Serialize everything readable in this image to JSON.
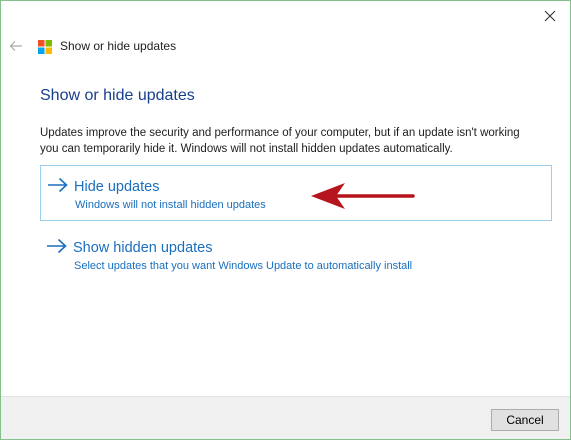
{
  "window": {
    "nav_title": "Show or hide updates"
  },
  "main": {
    "heading": "Show or hide updates",
    "description": "Updates improve the security and performance of your computer, but if an update isn't working you can temporarily hide it. Windows will not install hidden updates automatically.",
    "options": [
      {
        "title": "Hide updates",
        "subtitle": "Windows will not install hidden updates",
        "selected": true
      },
      {
        "title": "Show hidden updates",
        "subtitle": "Select updates that you want Windows Update to automatically install",
        "selected": false
      }
    ]
  },
  "footer": {
    "cancel_label": "Cancel"
  },
  "icons": {
    "close": "close-icon",
    "back": "back-arrow-icon",
    "logo": "windows-logo-icon",
    "option_arrow": "right-arrow-icon",
    "annotation": "red-annotation-arrow"
  },
  "colors": {
    "window_border": "#83c08a",
    "heading": "#183f8c",
    "link": "#1a6fbf",
    "selection_border": "#9ccfee",
    "annotation_arrow": "#b5141c",
    "footer_bg": "#f0f0f0"
  }
}
